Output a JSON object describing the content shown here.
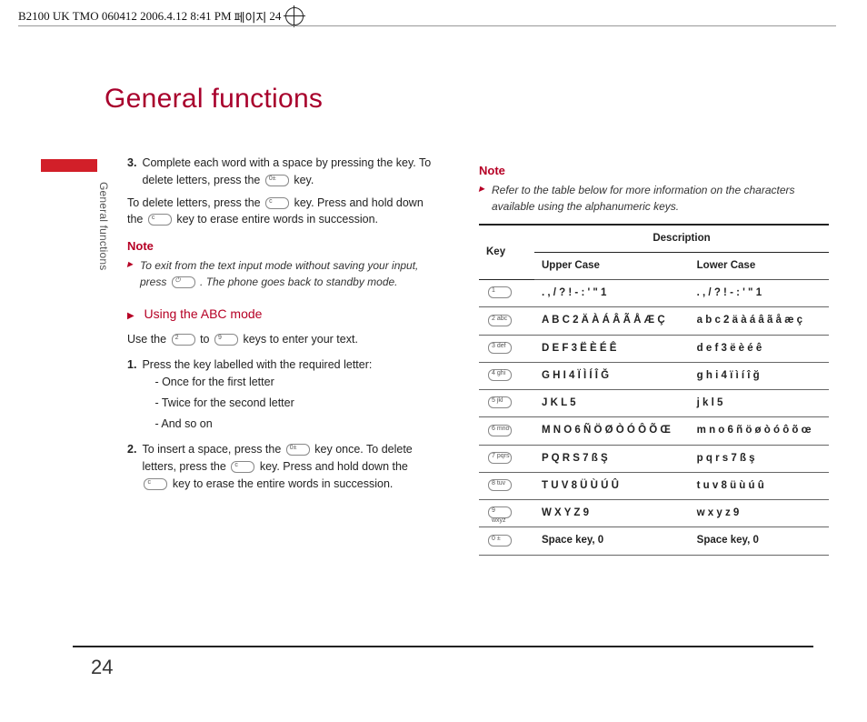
{
  "header": {
    "doc_id": "B2100 UK TMO 060412  2006.4.12 8:41 PM",
    "page_word": "페이지",
    "page_no": "24"
  },
  "side_label": "General functions",
  "title": "General functions",
  "left": {
    "step3_num": "3.",
    "step3_text": "Complete each word with a space by pressing the key. To delete letters, press the",
    "step3_tail": "key.",
    "para2a": "To delete letters, press the",
    "para2b": "key. Press and hold down the",
    "para2c": "key to erase entire words in succession.",
    "note_h": "Note",
    "note_body": "To exit from the text input mode without saving your input, press",
    "note_tail": ". The phone goes back to standby mode.",
    "sub_h": "Using the ABC mode",
    "use_a": "Use the",
    "use_b": "to",
    "use_c": "keys to enter your text.",
    "s1_num": "1.",
    "s1_text": "Press the key labelled with the required letter:",
    "s1_d1": "- Once for the first letter",
    "s1_d2": "- Twice for the second letter",
    "s1_d3": "- And so on",
    "s2_num": "2.",
    "s2_a": "To insert a space, press the",
    "s2_b": "key once. To delete letters, press the",
    "s2_c": "key. Press and hold down the",
    "s2_d": "key to erase the entire words in succession."
  },
  "right": {
    "note_h": "Note",
    "note_body": "Refer to the table below for more information on the characters available using the alphanumeric keys.",
    "th_key": "Key",
    "th_desc": "Description",
    "th_upper": "Upper Case",
    "th_lower": "Lower Case",
    "rows": [
      {
        "u": ". , / ? ! - : ' \" 1",
        "l": ". , / ? ! - : ' \" 1"
      },
      {
        "u": "A B C 2 Ä À Á Â Ã Å Æ Ç",
        "l": "a b c 2 ä à á â ã å æ ç"
      },
      {
        "u": "D E F 3 Ë È É Ê",
        "l": "d e f 3 ë è é ê"
      },
      {
        "u": "G H I 4 Ï Ì Í Î Ğ",
        "l": "g h i 4 ï ì í î ğ"
      },
      {
        "u": "J K L 5",
        "l": "j k l 5"
      },
      {
        "u": "M N O 6 Ñ Ö Ø Ò Ó Ô Õ Œ",
        "l": "m n o 6 ñ ö ø ò ó ô õ œ"
      },
      {
        "u": "P Q R S 7 ß Ş",
        "l": "p q r s 7 ß ş"
      },
      {
        "u": "T U V 8 Ü Ù Ú Û",
        "l": "t u v 8 ü ù ú û"
      },
      {
        "u": "W X Y Z 9",
        "l": "w x y z 9"
      },
      {
        "u": "Space key, 0",
        "l": "Space key, 0"
      }
    ],
    "key_glyphs": [
      "1",
      "2 abc",
      "3 def",
      "4 ghi",
      "5 jkl",
      "6 mno",
      "7 pqrs",
      "8 tuv",
      "9 wxyz",
      "0 ±"
    ]
  },
  "page_number": "24"
}
